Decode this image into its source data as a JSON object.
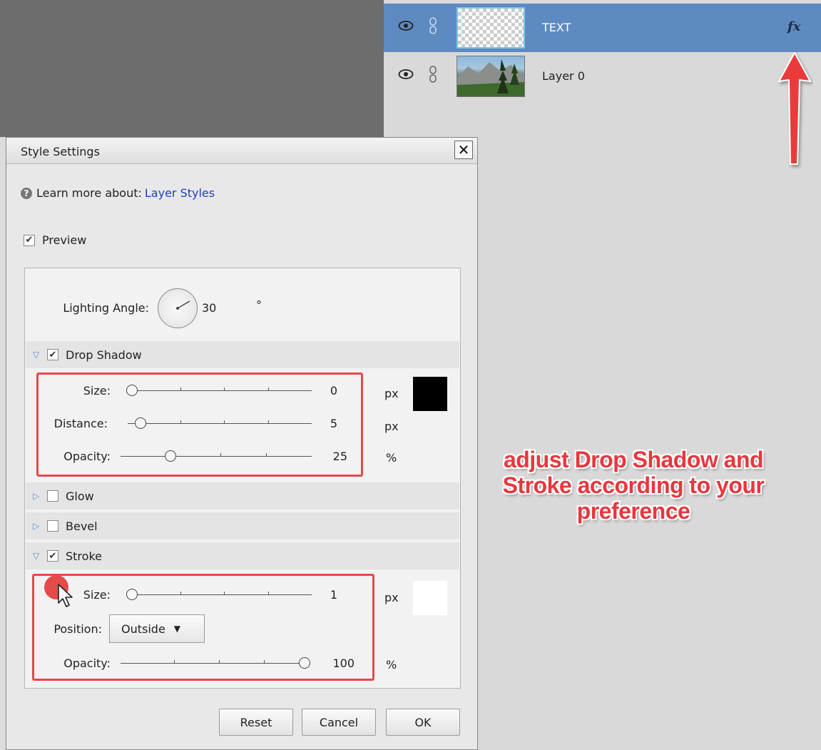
{
  "layers": [
    {
      "name": "TEXT",
      "selected": true,
      "has_fx": true
    },
    {
      "name": "Layer 0",
      "selected": false,
      "has_fx": false
    }
  ],
  "fx_label": "fx",
  "dialog": {
    "title": "Style Settings",
    "close_glyph": "✕",
    "learn_prefix": "Learn more about:",
    "learn_link": "Layer Styles",
    "preview_label": "Preview",
    "preview_checked": true
  },
  "lighting": {
    "label": "Lighting Angle:",
    "value": "30",
    "unit": "°"
  },
  "drop_shadow": {
    "label": "Drop Shadow",
    "checked": true,
    "expanded": true,
    "color": "#000000",
    "size": {
      "label": "Size:",
      "value": "0",
      "unit": "px",
      "fraction": 0.0
    },
    "distance": {
      "label": "Distance:",
      "value": "5",
      "unit": "px",
      "fraction": 0.05
    },
    "opacity": {
      "label": "Opacity:",
      "value": "25",
      "unit": "%",
      "fraction": 0.25
    }
  },
  "glow": {
    "label": "Glow",
    "checked": false,
    "expanded": false
  },
  "bevel": {
    "label": "Bevel",
    "checked": false,
    "expanded": false
  },
  "stroke": {
    "label": "Stroke",
    "checked": true,
    "expanded": true,
    "color": "#ffffff",
    "size": {
      "label": "Size:",
      "value": "1",
      "unit": "px",
      "fraction": 0.0
    },
    "position": {
      "label": "Position:",
      "value": "Outside"
    },
    "opacity": {
      "label": "Opacity:",
      "value": "100",
      "unit": "%",
      "fraction": 1.0
    }
  },
  "buttons": {
    "reset": "Reset",
    "cancel": "Cancel",
    "ok": "OK"
  },
  "annotation": "adjust Drop Shadow and Stroke according to your preference",
  "colors": {
    "accent_annotation": "#e8373f",
    "selected_layer": "#5e8ac2",
    "link": "#2040c0"
  }
}
